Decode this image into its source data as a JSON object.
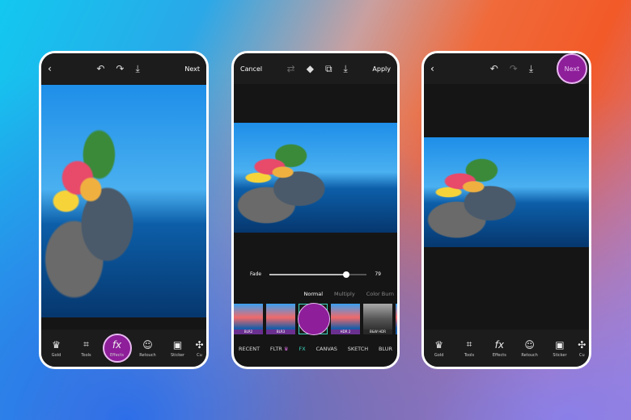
{
  "phone1": {
    "next": "Next",
    "tools": [
      {
        "icon": "crown-icon",
        "label": "Gold"
      },
      {
        "icon": "crop-icon",
        "label": "Tools"
      },
      {
        "icon": "fx-icon",
        "label": "Effects"
      },
      {
        "icon": "retouch-icon",
        "label": "Retouch"
      },
      {
        "icon": "sticker-icon",
        "label": "Sticker"
      },
      {
        "icon": "cutout-icon",
        "label": "Cu"
      }
    ]
  },
  "phone2": {
    "cancel": "Cancel",
    "apply": "Apply",
    "fade_label": "Fade",
    "fade_value": "79",
    "fade_fraction": 0.79,
    "blend_modes": [
      "Normal",
      "Multiply",
      "Color Burn"
    ],
    "selected_mode": "Normal",
    "thumbnails": [
      "BLR2",
      "BLR3",
      "",
      "HDR 2",
      "B&W HDR",
      ""
    ],
    "categories": [
      "RECENT",
      "FLTR",
      "FX",
      "CANVAS",
      "SKETCH",
      "BLUR"
    ],
    "active_category": "FX"
  },
  "phone3": {
    "next": "Next",
    "tools": [
      {
        "icon": "crown-icon",
        "label": "Gold"
      },
      {
        "icon": "crop-icon",
        "label": "Tools"
      },
      {
        "icon": "fx-icon",
        "label": "Effects"
      },
      {
        "icon": "retouch-icon",
        "label": "Retouch"
      },
      {
        "icon": "sticker-icon",
        "label": "Sticker"
      },
      {
        "icon": "cutout-icon",
        "label": "Cu"
      }
    ]
  },
  "colors": {
    "accent": "#8e1e9a",
    "active_category": "#3dd6c0"
  }
}
